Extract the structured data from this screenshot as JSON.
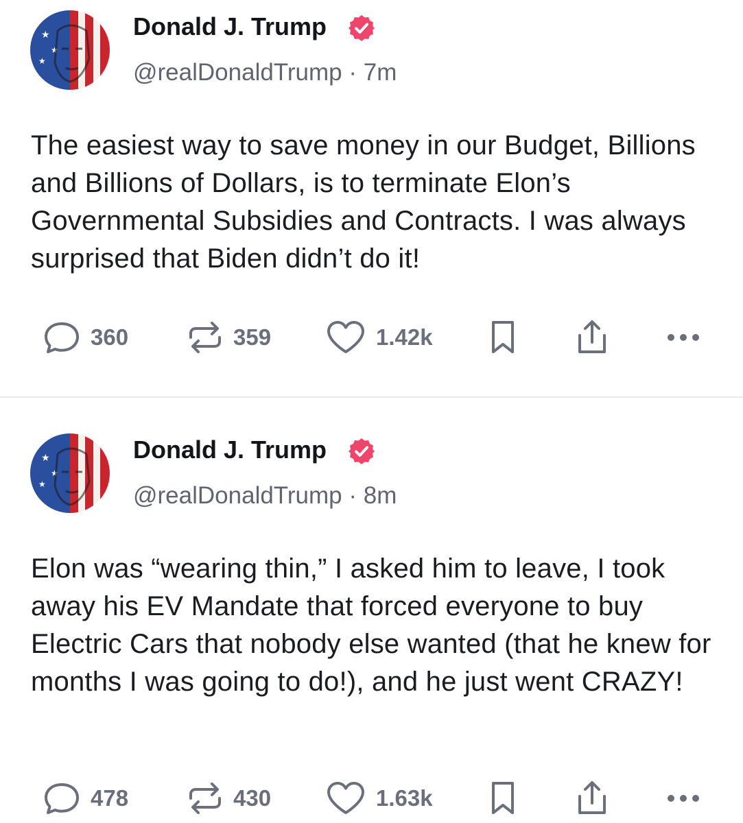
{
  "posts": [
    {
      "author": {
        "display_name": "Donald J. Trump",
        "handle": "@realDonaldTrump",
        "verified": true,
        "avatar_icon": "flag-portrait-avatar"
      },
      "separator": "·",
      "time": "7m",
      "text": "The easiest way to save money in our Budget, Billions and Billions of Dollars, is to terminate Elon’s Governmental Subsidies and Contracts. I was always surprised that Biden didn’t do it!",
      "actions": {
        "replies": "360",
        "reposts": "359",
        "likes": "1.42k"
      }
    },
    {
      "author": {
        "display_name": "Donald J. Trump",
        "handle": "@realDonaldTrump",
        "verified": true,
        "avatar_icon": "flag-portrait-avatar"
      },
      "separator": "·",
      "time": "8m",
      "text": "Elon was “wearing thin,” I asked him to leave, I took away his EV Mandate that forced everyone to buy Electric Cars that nobody else wanted (that he knew for months I was going to do!), and he just went CRAZY!",
      "actions": {
        "replies": "478",
        "reposts": "430",
        "likes": "1.63k"
      }
    }
  ],
  "icons": {
    "reply": "speech-bubble-icon",
    "repost": "repost-arrows-icon",
    "like": "heart-icon",
    "bookmark": "bookmark-icon",
    "share": "share-upload-icon",
    "more": "more-dots-icon",
    "verified": "verified-badge-icon"
  },
  "colors": {
    "verified_badge": "#f0456a",
    "action_gray": "#6b6f7b",
    "handle_gray": "#5f6470",
    "divider": "#e7e7ec"
  }
}
